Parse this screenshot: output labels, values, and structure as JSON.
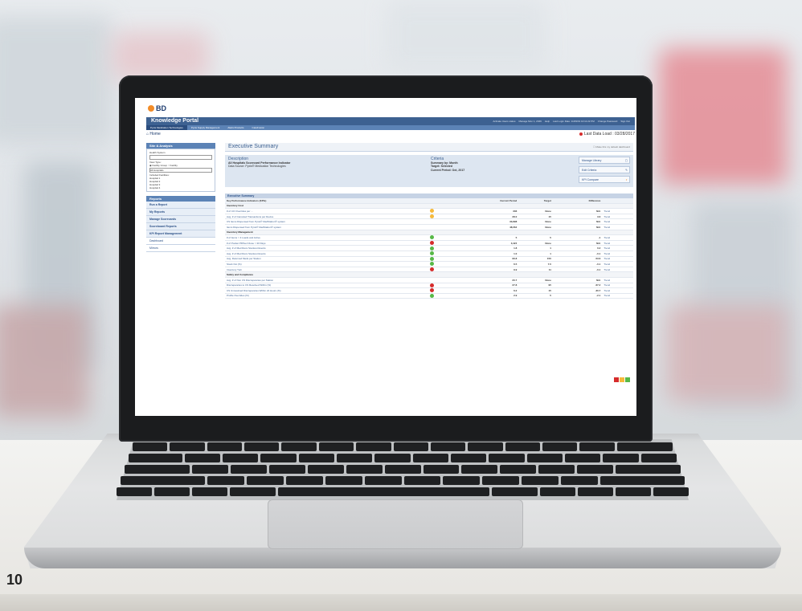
{
  "page": {
    "number": "10"
  },
  "portal": {
    "logo": "BD",
    "title": "Knowledge Portal",
    "header_links": [
      "Activate Users status",
      "Manage Mon 1, 2049",
      "Help",
      "Last Login Date: 11/09/19 10:11:22 PM",
      "Change Password",
      "Sign Out"
    ],
    "nav": [
      "Pyxis Medication Technologies",
      "Pyxis Supply Management",
      "Alaris Products",
      "CareFusion"
    ],
    "home": "Home",
    "last_data_load": "Last Data Load : 03/28/2017"
  },
  "sidebar": {
    "header": "Site & Analysis",
    "fields": [
      "Health System",
      "View Type:",
      "Facility Group",
      "Facility",
      "All Hospitals",
      "Included Facilities:",
      "Hospital 1",
      "Hospital 2",
      "Hospital 3",
      "Hospital 4"
    ],
    "reports_header": "Reports",
    "items": [
      "Run a Report",
      "My Reports",
      "Manage Scorecards",
      "Scoreboard Reports",
      "KPI Report Management",
      "Dashboard",
      "Mirrors"
    ]
  },
  "main": {
    "title": "Executive Summary",
    "save_note": "Make this my default dashboard",
    "description_header": "Description",
    "description_title": "All Hospitals Scorecard Performance Indicator",
    "data_source": "Data Source: Pyxis® Medication Technologies",
    "criteria_header": "Criteria",
    "criteria_lines": [
      "Summary by: Month",
      "Target: Selected",
      "Current Period: Oct, 2017"
    ],
    "buttons": [
      "Manage Library",
      "Edit Criteria",
      "KPI Compare"
    ],
    "section": "Executive Summary",
    "columns": [
      "Key Performance Indicators (KPIs)",
      "Current Period",
      "Target",
      "Difference"
    ],
    "rows": [
      {
        "group": "Inventory Cost"
      },
      {
        "name": "# of CO Overrides per ...",
        "ind": "orange",
        "current": "336",
        "target": "None",
        "diff": "N/A"
      },
      {
        "name": "Avg. # of Canceled Transactions per Device",
        "ind": "orange",
        "current": "28.0",
        "target": "15",
        "diff": "3.6"
      },
      {
        "name": "CS Items Dispensed from Pyxis® MedStation® system",
        "ind": "none",
        "current": "33,898",
        "target": "None",
        "diff": "N/A"
      },
      {
        "name": "Items Dispensed from Pyxis® MedStation® system",
        "ind": "none",
        "current": "48,064",
        "target": "None",
        "diff": "N/A"
      },
      {
        "group": "Inventory Management"
      },
      {
        "name": "# of Items > 3 Loads and Active",
        "ind": "green",
        "current": "5",
        "target": "5",
        "diff": "-1"
      },
      {
        "name": "# of Pocket PDTeel Close > 30 Days",
        "ind": "red",
        "current": "3,424",
        "target": "None",
        "diff": "N/A"
      },
      {
        "name": "Avg. # of Med Recs Stockout Events",
        "ind": "green",
        "current": "1.8",
        "target": "1",
        "diff": "0.2"
      },
      {
        "name": "Avg. # of Med Recs Stockout Events",
        "ind": "green",
        "current": "1.0",
        "target": "1",
        "diff": "-0.1"
      },
      {
        "name": "Avg. Returned Meds per Station",
        "ind": "green",
        "current": "96.8",
        "target": "150",
        "diff": "-53.6"
      },
      {
        "name": "Stock Out (%)",
        "ind": "green",
        "current": "6.5",
        "target": "7.0",
        "diff": "-0.1"
      },
      {
        "name": "Inventory Turn",
        "ind": "red",
        "current": "9.9",
        "target": "11",
        "diff": "-0.1"
      },
      {
        "group": "Safety and Compliance"
      },
      {
        "name": "Avg. # of Non CS Discrepancies per Station",
        "ind": "none",
        "current": "20.7",
        "target": "None",
        "diff": "N/A"
      },
      {
        "name": "Discrepancies to CS Resolved Within (%)",
        "ind": "red",
        "current": "27.8",
        "target": "95",
        "diff": "-67.2"
      },
      {
        "name": "CS Unresolved Discrepancies Within 24 Hours (%)",
        "ind": "red",
        "current": "6.2",
        "target": "15",
        "diff": "-30.7"
      },
      {
        "name": "Profile Overrides (%)",
        "ind": "green",
        "current": "2.9",
        "target": "5",
        "diff": "-2.1"
      }
    ],
    "trend_label": "Trend"
  },
  "colors": {
    "red": "#d62b2b",
    "orange": "#f5b93a",
    "green": "#57b847",
    "brand": "#3d6191"
  }
}
